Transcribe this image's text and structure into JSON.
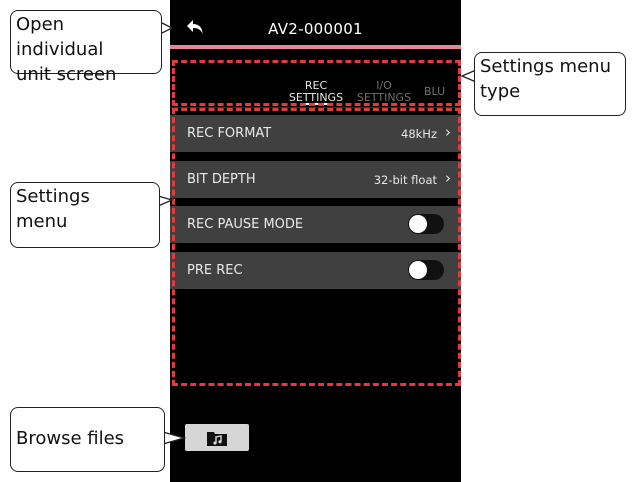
{
  "header": {
    "title": "AV2-000001",
    "back_icon": "undo-arrow-icon"
  },
  "tabs": [
    {
      "label": "REC\nSETTINGS",
      "active": true
    },
    {
      "label": "I/O\nSETTINGS",
      "active": false
    },
    {
      "label": "BLU",
      "active": false
    }
  ],
  "settings": [
    {
      "label": "REC FORMAT",
      "value": "48kHz",
      "type": "select"
    },
    {
      "label": "BIT DEPTH",
      "value": "32-bit float",
      "type": "select"
    },
    {
      "label": "REC PAUSE MODE",
      "type": "toggle",
      "on": false
    },
    {
      "label": "PRE REC",
      "type": "toggle",
      "on": false
    }
  ],
  "browse": {
    "icon": "music-folder-icon"
  },
  "callouts": {
    "open_unit": "Open individual\nunit screen",
    "menu_type": "Settings menu\ntype",
    "settings_menu": "Settings\nmenu",
    "browse_files": "Browse files"
  },
  "colors": {
    "accent_pink": "#e9839a",
    "highlight_red": "#e23b3b",
    "row_bg": "#404040"
  }
}
